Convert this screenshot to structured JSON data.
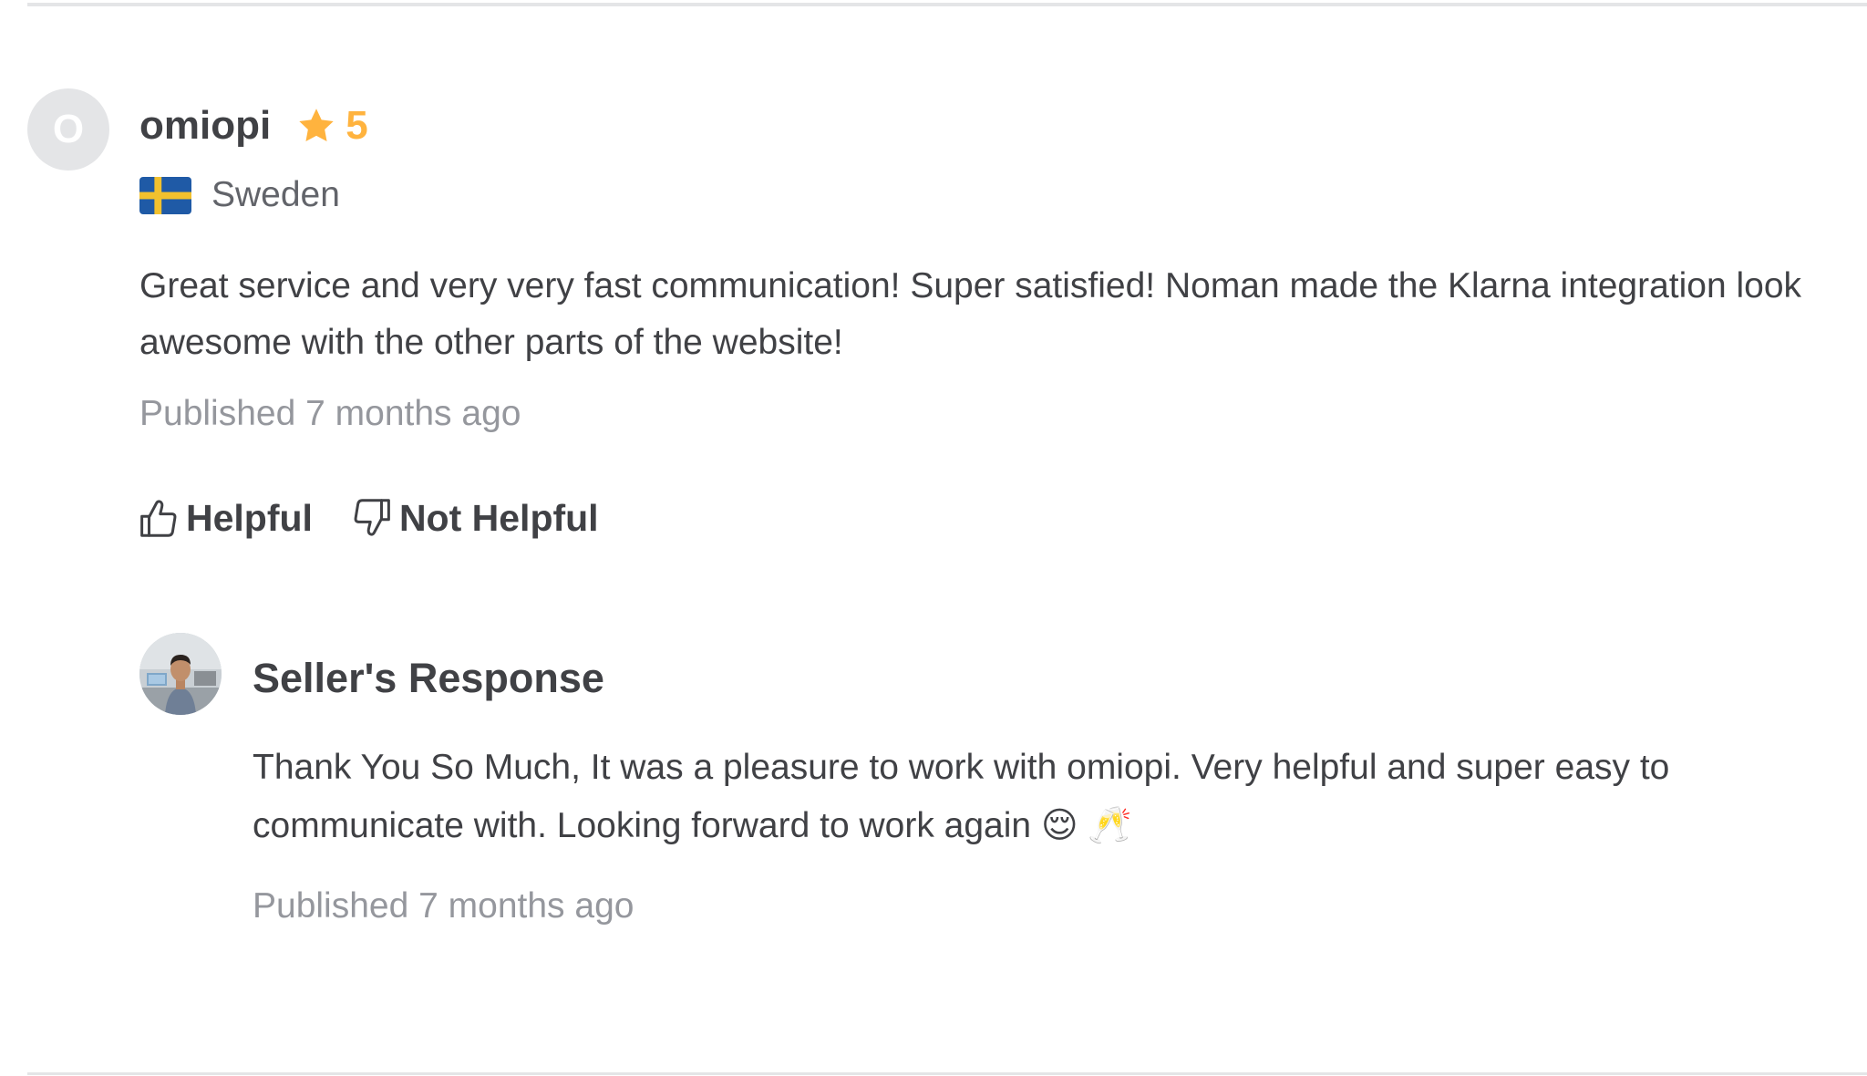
{
  "review": {
    "avatar_initial": "O",
    "username": "omiopi",
    "rating": "5",
    "country": "Sweden",
    "text": "Great service and very very fast communication! Super satisfied! Noman made the Klarna integration look awesome with the other parts of the website!",
    "published": "Published 7 months ago",
    "helpful_label": "Helpful",
    "not_helpful_label": "Not Helpful"
  },
  "seller_response": {
    "title": "Seller's Response",
    "text": "Thank You So Much, It was a pleasure to work with omiopi. Very helpful and super easy to communicate with. Looking forward to work again 😌 🥂",
    "published": "Published 7 months ago"
  },
  "icons": {
    "star": "star-icon",
    "flag": "sweden-flag-icon",
    "thumbs_up": "thumbs-up-icon",
    "thumbs_down": "thumbs-down-icon"
  },
  "colors": {
    "star": "#ffb33e",
    "text": "#404145",
    "muted": "#95979d",
    "divider": "#e4e5e7",
    "avatar_bg": "#e4e5e7"
  }
}
